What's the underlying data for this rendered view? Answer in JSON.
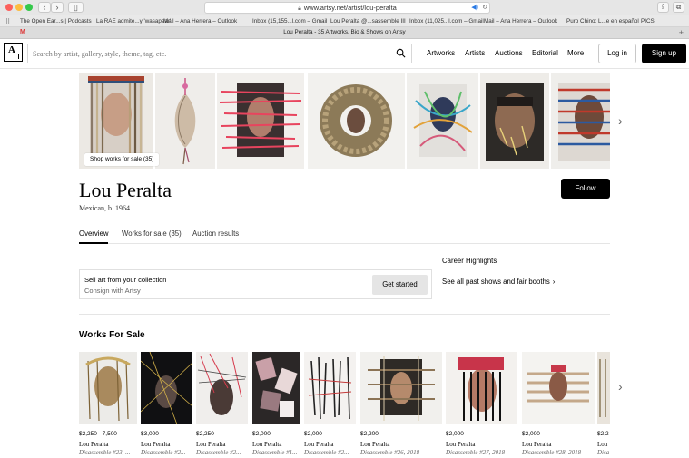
{
  "browser": {
    "url": "www.artsy.net/artist/lou-peralta",
    "tab_title": "Lou Peralta - 35 Artworks, Bio & Shows on Artsy",
    "bookmarks": [
      "The Open Ear...s | Podcasts",
      "La RAE admite...y 'wasapear'",
      "Mail – Ana Herrera – Outlook",
      "Inbox (15,155...l.com – Gmail",
      "Lou Peralta @...sassemble III",
      "Inbox (11,025...l.com – Gmail",
      "Mail – Ana Herrera – Outlook",
      "Puro Chino: L...e en español",
      "PICS"
    ]
  },
  "header": {
    "logo_letter": "A",
    "search_placeholder": "Search by artist, gallery, style, theme, tag, etc.",
    "nav": [
      "Artworks",
      "Artists",
      "Auctions",
      "Editorial",
      "More"
    ],
    "login_label": "Log in",
    "signup_label": "Sign up"
  },
  "hero": {
    "shop_label": "Shop works for sale (35)"
  },
  "artist": {
    "name": "Lou Peralta",
    "meta": "Mexican, b. 1964",
    "follow_label": "Follow"
  },
  "tabs": [
    "Overview",
    "Works for sale (35)",
    "Auction results"
  ],
  "sell": {
    "title": "Sell art from your collection",
    "subtitle": "Consign with Artsy",
    "button": "Get started"
  },
  "career": {
    "title": "Career Highlights",
    "link": "See all past shows and fair booths"
  },
  "works_for_sale": {
    "title": "Works For Sale",
    "items": [
      {
        "price": "$2,250 - 7,500",
        "artist": "Lou Peralta",
        "title": "Disassemble #23, ..."
      },
      {
        "price": "$3,000",
        "artist": "Lou Peralta",
        "title": "Disassemble #2..."
      },
      {
        "price": "$2,250",
        "artist": "Lou Peralta",
        "title": "Disassemble #2..."
      },
      {
        "price": "$2,000",
        "artist": "Lou Peralta",
        "title": "Disassemble #1..."
      },
      {
        "price": "$2,000",
        "artist": "Lou Peralta",
        "title": "Disassemble #2..."
      },
      {
        "price": "$2,200",
        "artist": "Lou Peralta",
        "title": "Disassemble #26, 2018"
      },
      {
        "price": "$2,000",
        "artist": "Lou Peralta",
        "title": "Disassemble #27, 2018"
      },
      {
        "price": "$2,000",
        "artist": "Lou Peralta",
        "title": "Disassemble #28, 2018"
      },
      {
        "price": "$2,2",
        "artist": "Lou",
        "title": "Disa"
      }
    ]
  }
}
